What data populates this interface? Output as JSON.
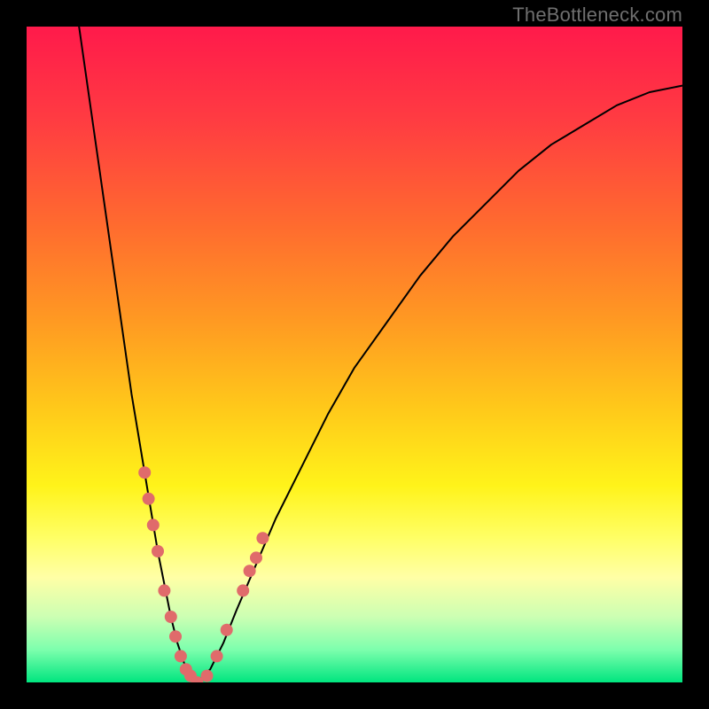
{
  "watermark": "TheBottleneck.com",
  "chart_data": {
    "type": "line",
    "title": "",
    "xlabel": "",
    "ylabel": "",
    "xlim": [
      0,
      100
    ],
    "ylim": [
      0,
      100
    ],
    "grid": false,
    "legend": false,
    "background_gradient_stops": [
      {
        "offset": 0.0,
        "color": "#ff1a4b"
      },
      {
        "offset": 0.14,
        "color": "#ff3b42"
      },
      {
        "offset": 0.3,
        "color": "#ff6a2f"
      },
      {
        "offset": 0.45,
        "color": "#ff9a22"
      },
      {
        "offset": 0.58,
        "color": "#ffc81a"
      },
      {
        "offset": 0.7,
        "color": "#fff31a"
      },
      {
        "offset": 0.78,
        "color": "#ffff66"
      },
      {
        "offset": 0.84,
        "color": "#ffffa6"
      },
      {
        "offset": 0.9,
        "color": "#ccffb3"
      },
      {
        "offset": 0.95,
        "color": "#7dffad"
      },
      {
        "offset": 1.0,
        "color": "#00e57f"
      }
    ],
    "series": [
      {
        "name": "bottleneck-curve-left",
        "stroke": "#000000",
        "stroke_width": 2,
        "points": [
          {
            "x": 8,
            "y": 100
          },
          {
            "x": 9,
            "y": 93
          },
          {
            "x": 10,
            "y": 86
          },
          {
            "x": 11,
            "y": 79
          },
          {
            "x": 12,
            "y": 72
          },
          {
            "x": 13,
            "y": 65
          },
          {
            "x": 14,
            "y": 58
          },
          {
            "x": 15,
            "y": 51
          },
          {
            "x": 16,
            "y": 44
          },
          {
            "x": 17,
            "y": 38
          },
          {
            "x": 18,
            "y": 32
          },
          {
            "x": 19,
            "y": 26
          },
          {
            "x": 20,
            "y": 20
          },
          {
            "x": 21,
            "y": 15
          },
          {
            "x": 22,
            "y": 10
          },
          {
            "x": 23,
            "y": 6
          },
          {
            "x": 24,
            "y": 3
          },
          {
            "x": 25,
            "y": 1
          },
          {
            "x": 26,
            "y": 0
          }
        ]
      },
      {
        "name": "bottleneck-curve-right",
        "stroke": "#000000",
        "stroke_width": 2,
        "points": [
          {
            "x": 26,
            "y": 0
          },
          {
            "x": 28,
            "y": 2
          },
          {
            "x": 30,
            "y": 6
          },
          {
            "x": 32,
            "y": 11
          },
          {
            "x": 35,
            "y": 18
          },
          {
            "x": 38,
            "y": 25
          },
          {
            "x": 42,
            "y": 33
          },
          {
            "x": 46,
            "y": 41
          },
          {
            "x": 50,
            "y": 48
          },
          {
            "x": 55,
            "y": 55
          },
          {
            "x": 60,
            "y": 62
          },
          {
            "x": 65,
            "y": 68
          },
          {
            "x": 70,
            "y": 73
          },
          {
            "x": 75,
            "y": 78
          },
          {
            "x": 80,
            "y": 82
          },
          {
            "x": 85,
            "y": 85
          },
          {
            "x": 90,
            "y": 88
          },
          {
            "x": 95,
            "y": 90
          },
          {
            "x": 100,
            "y": 91
          }
        ]
      }
    ],
    "markers": {
      "name": "highlight-dots",
      "color": "#e06b6b",
      "radius": 7,
      "points": [
        {
          "x": 18.0,
          "y": 32
        },
        {
          "x": 18.6,
          "y": 28
        },
        {
          "x": 19.3,
          "y": 24
        },
        {
          "x": 20.0,
          "y": 20
        },
        {
          "x": 21.0,
          "y": 14
        },
        {
          "x": 22.0,
          "y": 10
        },
        {
          "x": 22.7,
          "y": 7
        },
        {
          "x": 23.5,
          "y": 4
        },
        {
          "x": 24.3,
          "y": 2
        },
        {
          "x": 25.0,
          "y": 1
        },
        {
          "x": 26.0,
          "y": 0
        },
        {
          "x": 27.5,
          "y": 1
        },
        {
          "x": 29.0,
          "y": 4
        },
        {
          "x": 30.5,
          "y": 8
        },
        {
          "x": 33.0,
          "y": 14
        },
        {
          "x": 34.0,
          "y": 17
        },
        {
          "x": 35.0,
          "y": 19
        },
        {
          "x": 36.0,
          "y": 22
        }
      ]
    }
  }
}
